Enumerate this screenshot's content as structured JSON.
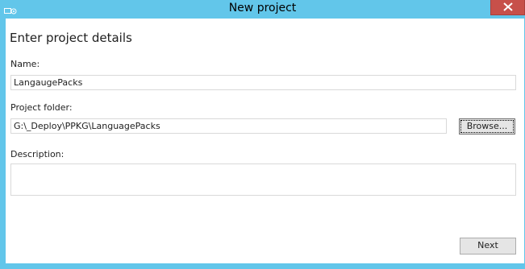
{
  "window": {
    "title": "New project",
    "close_icon": "close-icon",
    "app_icon": "provisioning-app-icon"
  },
  "form": {
    "heading": "Enter project details",
    "name_label": "Name:",
    "name_value": "LangaugePacks",
    "folder_label": "Project folder:",
    "folder_value": "G:\\_Deploy\\PPKG\\LanguagePacks",
    "browse_label": "Browse...",
    "description_label": "Description:",
    "description_value": ""
  },
  "footer": {
    "next_label": "Next"
  },
  "colors": {
    "title_bar": "#62c6ea",
    "close_button": "#c7504a"
  }
}
